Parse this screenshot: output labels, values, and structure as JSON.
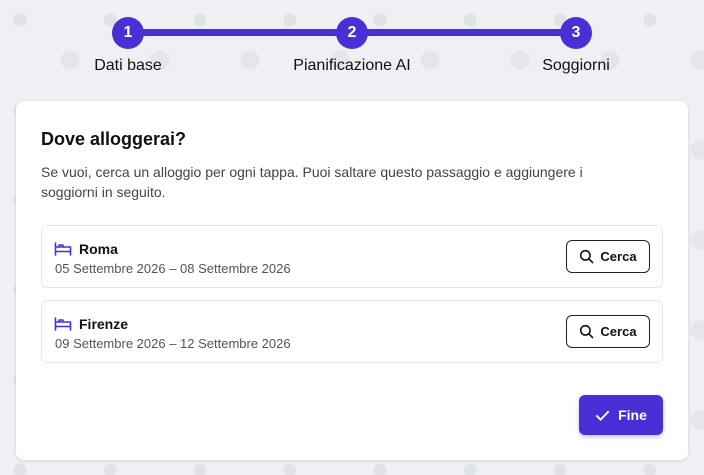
{
  "stepper": {
    "steps": [
      {
        "number": "1",
        "label": "Dati base"
      },
      {
        "number": "2",
        "label": "Pianificazione AI"
      },
      {
        "number": "3",
        "label": "Soggiorni"
      }
    ]
  },
  "card": {
    "title": "Dove alloggerai?",
    "description": "Se vuoi, cerca un alloggio per ogni tappa. Puoi saltare questo passaggio e aggiungere i soggiorni in seguito.",
    "stays": [
      {
        "icon": "bed-icon",
        "city": "Roma",
        "dates": "05 Settembre 2026 – 08 Settembre 2026",
        "button_label": "Cerca"
      },
      {
        "icon": "bed-icon",
        "city": "Firenze",
        "dates": "09 Settembre 2026 – 12 Settembre 2026",
        "button_label": "Cerca"
      }
    ],
    "finish_label": "Fine"
  },
  "colors": {
    "accent": "#4a2fd6",
    "background": "#eef0f3",
    "card": "#ffffff"
  }
}
